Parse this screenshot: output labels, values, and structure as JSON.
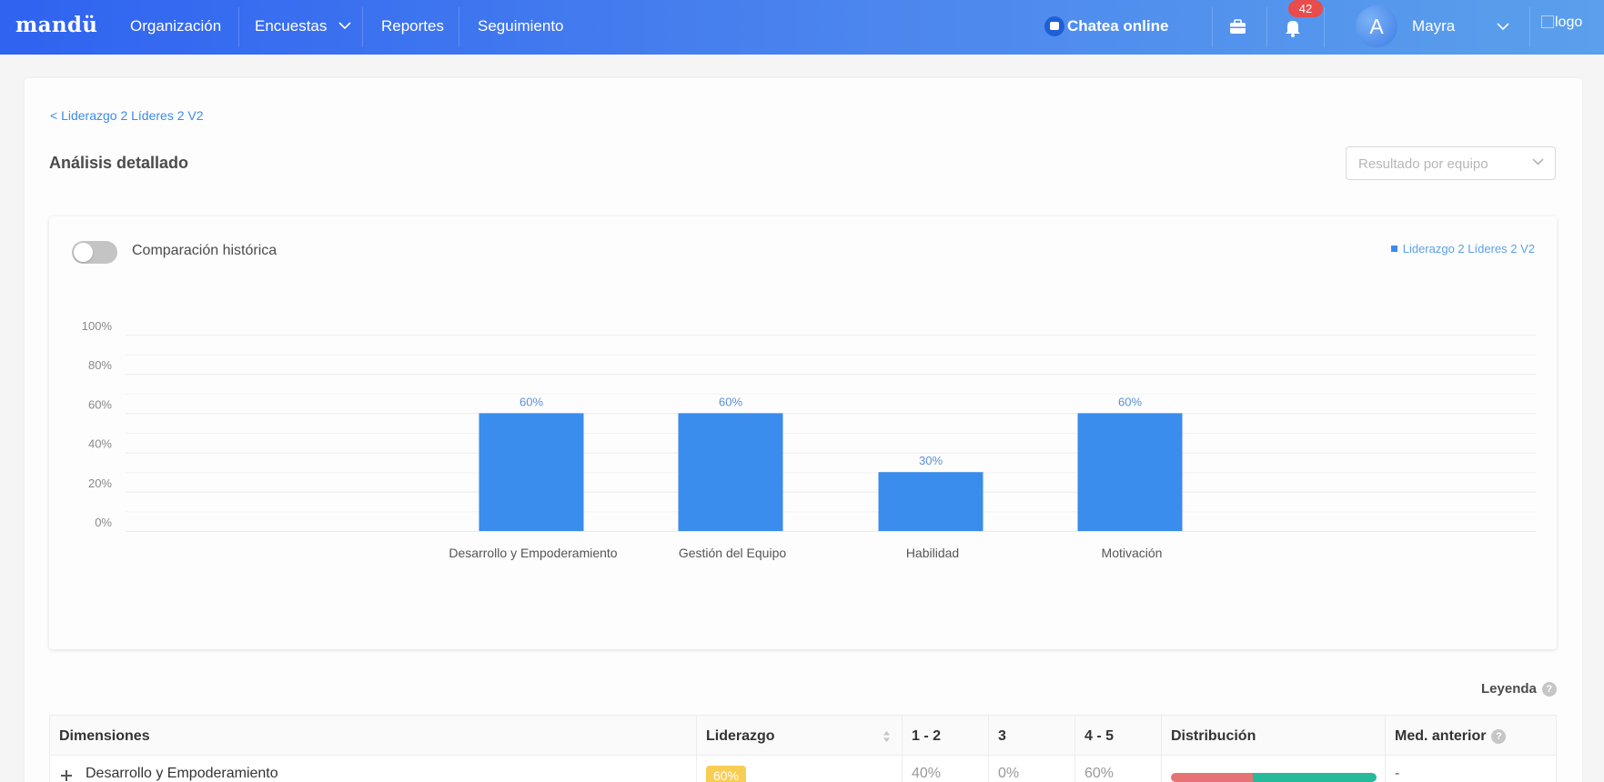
{
  "app": {
    "brand": "mandü",
    "nav": [
      "Organización",
      "Encuestas",
      "Reportes",
      "Seguimiento"
    ],
    "chat_label": "Chatea online",
    "notifications_count": "42",
    "user_initial": "A",
    "user_name": "Mayra",
    "logo_alt": "logo"
  },
  "page": {
    "breadcrumb": "< Liderazgo 2 Líderes 2 V2",
    "title": "Análisis detallado",
    "select_placeholder": "Resultado por equipo",
    "toggle_label": "Comparación histórica",
    "legend_label": "Liderazgo 2 Líderes 2 V2",
    "leyenda_label": "Leyenda"
  },
  "colors": {
    "accent": "#3a8ced",
    "bar": "#3a8ced",
    "badge": "#ea4b4b",
    "pill": "#f8cd54",
    "dist_red": "#e57373",
    "dist_green": "#26b99a"
  },
  "chart_data": {
    "type": "bar",
    "categories": [
      "Desarrollo y Empoderamiento",
      "Gestión del Equipo",
      "Habilidad",
      "Motivación"
    ],
    "series": [
      {
        "name": "Liderazgo 2 Líderes 2 V2",
        "values": [
          60,
          60,
          30,
          60
        ]
      }
    ],
    "data_labels": [
      "60%",
      "60%",
      "30%",
      "60%"
    ],
    "y_ticks": [
      "0%",
      "20%",
      "40%",
      "60%",
      "80%",
      "100%"
    ],
    "ylim": [
      0,
      100
    ],
    "grid": true,
    "legend_position": "top-right"
  },
  "table": {
    "headers": [
      "Dimensiones",
      "Liderazgo",
      "1 - 2",
      "3",
      "4 - 5",
      "Distribución",
      "Med. anterior"
    ],
    "rows": [
      {
        "dimension": "Desarrollo y Empoderamiento",
        "liderazgo": "60%",
        "r12": "40%",
        "r3": "0%",
        "r45": "60%",
        "dist_red": 0.4,
        "dist_green": 0.6,
        "previous": "-"
      }
    ]
  }
}
